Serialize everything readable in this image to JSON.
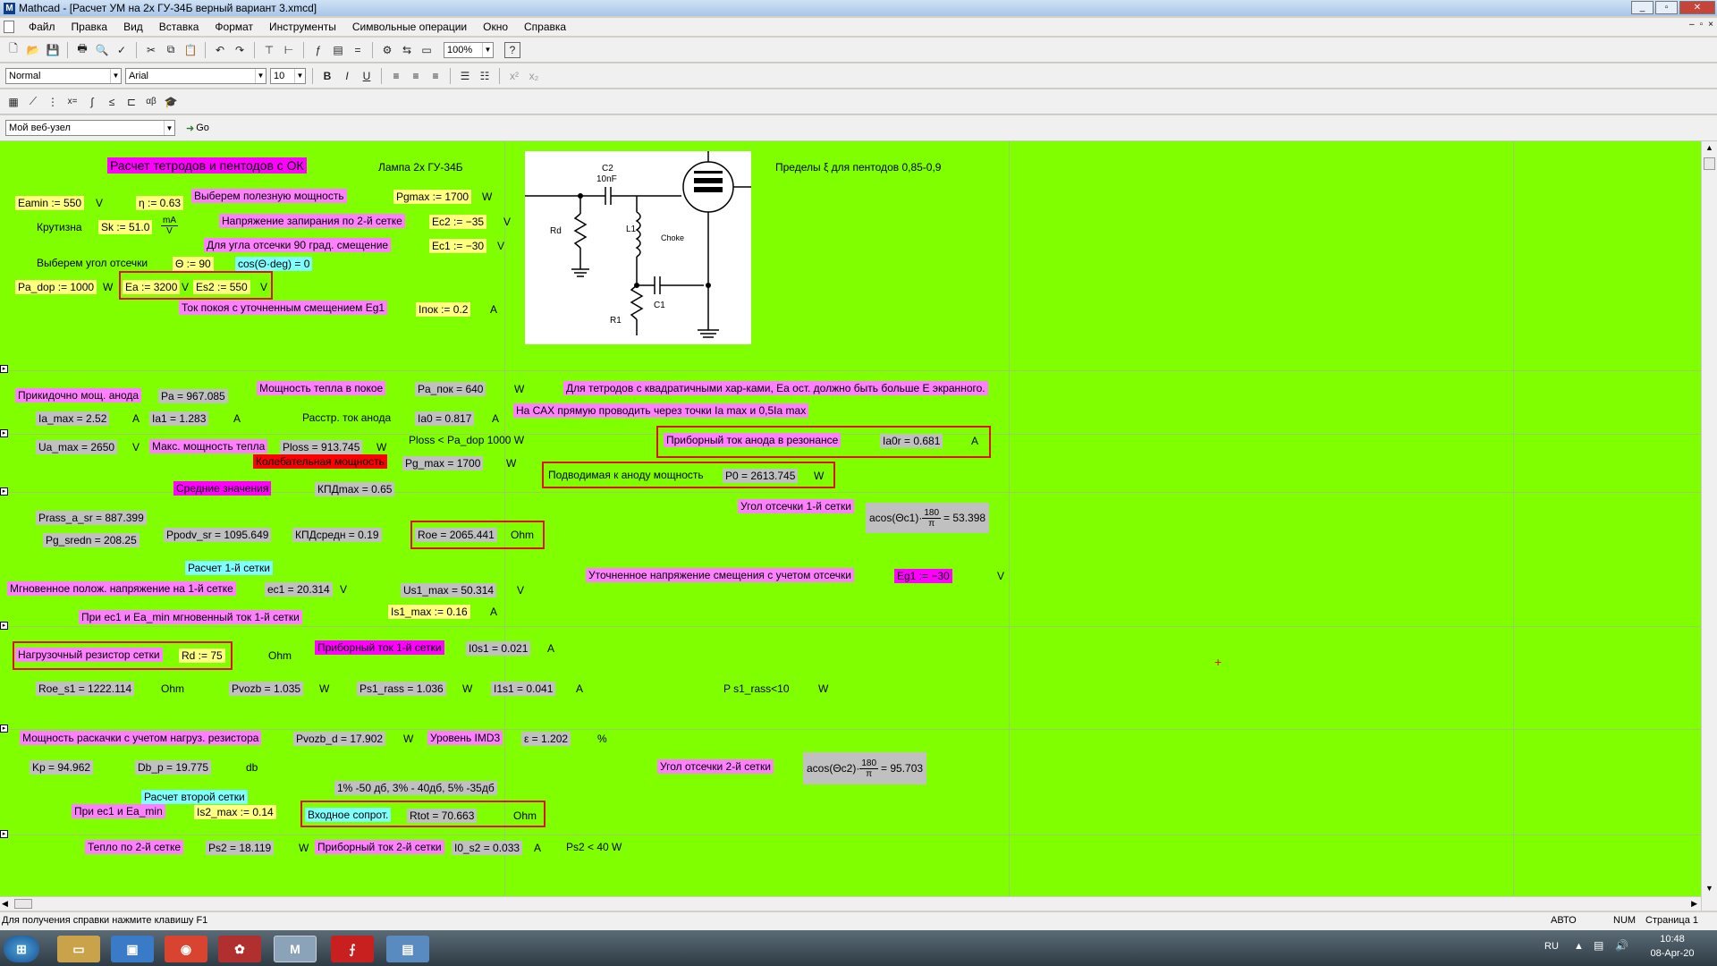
{
  "window": {
    "app_letter": "M",
    "title": "Mathcad - [Расчет УМ на 2х ГУ-34Б  верный вариант 3.xmcd]",
    "buttons": [
      "_",
      "▫",
      "✕"
    ],
    "mdi_buttons": [
      "–",
      "▫",
      "×"
    ]
  },
  "menu": [
    "Файл",
    "Правка",
    "Вид",
    "Вставка",
    "Формат",
    "Инструменты",
    "Символьные операции",
    "Окно",
    "Справка"
  ],
  "toolbar1": {
    "zoom": "100%"
  },
  "toolbar2": {
    "style": "Normal",
    "font": "Arial",
    "size": "10"
  },
  "toolbar4": {
    "url_select": "Мой веб-узел",
    "go_label": "Go"
  },
  "ws": {
    "title": "Расчет тетродов и пентодов с ОК",
    "lamp": "Лампа 2х ГУ-34Б",
    "limits": "Пределы ξ для пентодов  0,85-0,9",
    "eamin": "Eamin := 550",
    "u_v": "V",
    "eta": "η := 0.63",
    "choose_power": "Выберем полезную мощность",
    "pgmax_def": "Pgmax := 1700",
    "u_w": "W",
    "krutizna": "Крутизна",
    "sk": "Sk := 51.0",
    "sk_num": "mA",
    "sk_den": "V",
    "cutoff_v2": "Напряжение запирания по 2-й сетке",
    "ec2": "Ec2 := −35",
    "bias90": "Для угла отсечки 90 град. смещение",
    "ec1": "Ec1 := −30",
    "choose_angle": "Выберем угол отсечки",
    "theta": "Θ := 90",
    "cos": "cos(Θ·deg) = 0",
    "pa_dop": "Pa_dop := 1000",
    "ea": "Ea := 3200",
    "es2": "Es2 := 550",
    "quiescent": "Ток покоя с уточненным смещением Eg1",
    "ipok": "Iпок := 0.2",
    "u_a": "A",
    "anode_power_label": "Прикидочно мощ. анода",
    "pa": "Pa = 967.085",
    "heat_quiet_label": "Мощность тепла в покое",
    "pa_pok": "Pa_пок = 640",
    "tetrode_note": "Для тетродов с квадратичными хар-ками, Ea ост. должно быть больше E экранного.",
    "ia_max": "Ia_max = 2.52",
    "ia1": "Ia1 = 1.283",
    "rasstr_label": "Расстр. ток анода",
    "ia0": "Ia0 = 0.817",
    "sah_note": "На САХ прямую проводить через точки Ia max  и 0,5Ia max",
    "ua_max": "Ua_max = 2650",
    "max_heat_label": "Макс. мощность тепла",
    "ploss": "Ploss = 913.745",
    "ploss_note": "Ploss < Pa_dop 1000 W",
    "resonance_label": "Приборный ток анода  в резонансе",
    "ia0r": "Ia0r = 0.681",
    "osc_power_label": "Колебательная мощность",
    "pg_max": "Pg_max = 1700",
    "supplied_label": "Подводимая к аноду мощность",
    "p0": "P0 = 2613.745",
    "avg_label": "Средние значения",
    "kpd_max": "КПДmax = 0.65",
    "angle1_label": "Угол отсечки 1-й сетки",
    "acos1_left": "acos(Θc1)·",
    "acos1_right": "= 53.398",
    "frac_180": "180",
    "frac_pi": "π",
    "prass": "Prass_a_sr = 887.399",
    "pg_sredn": "Pg_sredn = 208.25",
    "ppodv": "Ppodv_sr = 1095.649",
    "kpd_sredn": "КПДсредн = 0.19",
    "roe": "Roe = 2065.441",
    "u_ohm": "Ohm",
    "grid1_calc": "Расчет 1-й сетки",
    "bias_refined_label": "Уточненное напряжение смещения с учетом отсечки",
    "eg1": "Eg1 := −30",
    "inst_label": "Мгновенное полож. напряжение на 1-й сетке",
    "ec1_val": "ec1 = 20.314",
    "us1": "Us1_max = 50.314",
    "inst_current_label": "При ec1  и Ea_min мгновенный ток 1-й сетки",
    "is1": "Is1_max := 0.16",
    "rd_label": "Нагрузочный резистор сетки",
    "rd": "Rd := 75",
    "grid1_current_label": "Приборный ток 1-й сетки",
    "i0s1": "I0s1 = 0.021",
    "roe_s1": "Roe_s1 = 1222.114",
    "pvozb": "Pvozb = 1.035",
    "ps1_rass": "Ps1_rass = 1.036",
    "i1s1": "I1s1 = 0.041",
    "ps1_note": "P s1_rass<10",
    "drive_label": "Мощность раскачки с учетом нагруз. резистора",
    "pvozb_d": "Pvozb_d = 17.902",
    "imd_label": "Уровень IMD3",
    "eps": "ε = 1.202",
    "u_pct": "%",
    "kp": "Kp = 94.962",
    "db_p": "Db_p = 19.775",
    "u_db": "db",
    "angle2_label": "Угол отсечки 2-й сетки",
    "acos2_left": "acos(Θc2)·",
    "acos2_right": "= 95.703",
    "imd_note": "1% -50 дб, 3% - 40дб, 5% -35дб",
    "grid2_calc": "Расчет второй сетки",
    "at_ec1": "При ec1 и Ea_min",
    "is2": "Is2_max := 0.14",
    "input_res_label": "Входное сопрот.",
    "rtot": "Rtot = 70.663",
    "heat2_label": "Тепло по 2-й сетке",
    "ps2": "Ps2 = 18.119",
    "grid2_current_label": "Приборный ток 2-й сетки",
    "i0s2": "I0_s2 = 0.033",
    "ps2_note": "Ps2 < 40 W",
    "cursor": "+"
  },
  "schematic": {
    "c2": "C2",
    "c2val": "10nF",
    "rd": "Rd",
    "l1": "L1",
    "choke": "Choke",
    "r1": "R1",
    "c1": "C1"
  },
  "status": {
    "help": "Для получения справки нажмите клавишу F1",
    "mode": "АВТО",
    "num": "NUM",
    "page": "Страница 1"
  },
  "taskbar": {
    "lang": "RU",
    "time": "10:48",
    "date": "08-Apr-20"
  }
}
